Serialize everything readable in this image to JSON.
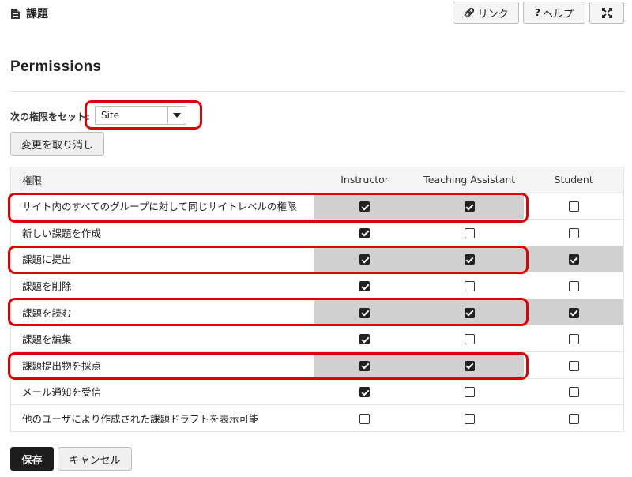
{
  "header": {
    "title": "課題",
    "link_label": "リンク",
    "help_label": "ヘルプ"
  },
  "section_title": "Permissions",
  "role_selector": {
    "label": "次の権限をセット:",
    "value": "Site"
  },
  "undo_label": "変更を取り消し",
  "table": {
    "columns": [
      "権限",
      "Instructor",
      "Teaching Assistant",
      "Student"
    ],
    "rows": [
      {
        "label": "サイト内のすべてのグループに対して同じサイトレベルの権限",
        "instructor": true,
        "ta": true,
        "student": false
      },
      {
        "label": "新しい課題を作成",
        "instructor": true,
        "ta": false,
        "student": false
      },
      {
        "label": "課題に提出",
        "instructor": true,
        "ta": true,
        "student": true
      },
      {
        "label": "課題を削除",
        "instructor": true,
        "ta": false,
        "student": false
      },
      {
        "label": "課題を読む",
        "instructor": true,
        "ta": true,
        "student": true
      },
      {
        "label": "課題を編集",
        "instructor": true,
        "ta": false,
        "student": false
      },
      {
        "label": "課題提出物を採点",
        "instructor": true,
        "ta": true,
        "student": false
      },
      {
        "label": "メール通知を受信",
        "instructor": true,
        "ta": false,
        "student": false
      },
      {
        "label": "他のユーザにより作成された課題ドラフトを表示可能",
        "instructor": false,
        "ta": false,
        "student": false
      }
    ]
  },
  "footer": {
    "save_label": "保存",
    "cancel_label": "キャンセル"
  },
  "colors": {
    "highlight": "#e00000",
    "shaded_row": "#d0d0d0",
    "primary_button": "#1d1d1d"
  }
}
